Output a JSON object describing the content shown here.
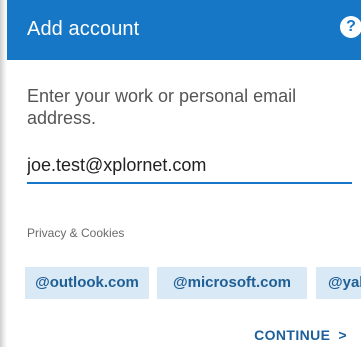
{
  "header": {
    "title": "Add account",
    "help_icon": "?"
  },
  "form": {
    "prompt": "Enter your work or personal email address.",
    "email_value": "joe.test@xplornet.com",
    "privacy_label": "Privacy & Cookies"
  },
  "suggestions": [
    "@outlook.com",
    "@microsoft.com",
    "@yah"
  ],
  "actions": {
    "continue_label": "CONTINUE",
    "continue_chevron": ">"
  },
  "colors": {
    "accent": "#1677c6",
    "chip_bg": "#d9e9f6",
    "chip_text": "#1f5f95"
  }
}
